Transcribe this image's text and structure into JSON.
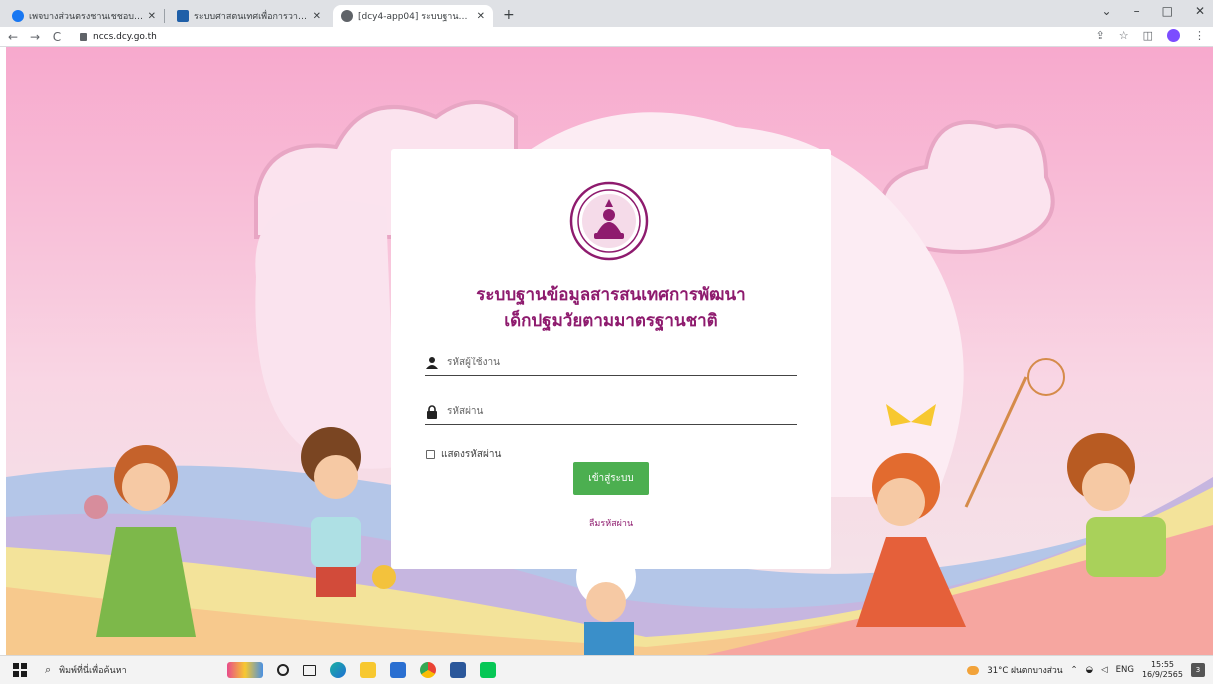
{
  "browser": {
    "tabs": [
      {
        "label": "เพจบางส่วนตรงชานเชชอบ | Facebo...",
        "favicon_color": "#1877f2",
        "active": false
      },
      {
        "label": "ระบบศาสตนเทศเพื่อการวางแผนแผนประ...",
        "favicon_color": "#1f5fa8",
        "active": false
      },
      {
        "label": "[dcy4-app04] ระบบฐานข้อมูลศาสตร...",
        "favicon_color": "#5f6368",
        "active": true
      }
    ],
    "new_tab": "+",
    "controls": {
      "chevron": "⌄",
      "minimize": "–",
      "maximize": "□",
      "close": "✕"
    },
    "nav": {
      "back": "←",
      "forward": "→",
      "reload": "C"
    },
    "url": "nccs.dcy.go.th",
    "tools": {
      "share": "⇪",
      "star": "☆",
      "sidebar": "◫",
      "menu": "⋮"
    }
  },
  "login": {
    "title_line1": "ระบบฐานข้อมูลสารสนเทศการพัฒนา",
    "title_line2": "เด็กปฐมวัยตามมาตรฐานชาติ",
    "username_placeholder": "รหัสผู้ใช้งาน",
    "password_placeholder": "รหัสผ่าน",
    "show_password_label": "แสดงรหัสผ่าน",
    "login_button": "เข้าสู่ระบบ",
    "forgot_password": "ลืมรหัสผ่าน",
    "accent_color": "#8e1b6e",
    "button_color": "#4caf50"
  },
  "taskbar": {
    "search_placeholder": "พิมพ์ที่นี่เพื่อค้นหา",
    "weather": "31°C ฝนตกบางส่วน",
    "lang": "ENG",
    "time": "15:55",
    "date": "16/9/2565",
    "notif_count": "3",
    "apps": [
      "event-icon",
      "cortana-icon",
      "taskview-icon",
      "edge-icon",
      "file-explorer-icon",
      "mail-icon",
      "chrome-icon",
      "word-icon",
      "line-icon"
    ]
  }
}
